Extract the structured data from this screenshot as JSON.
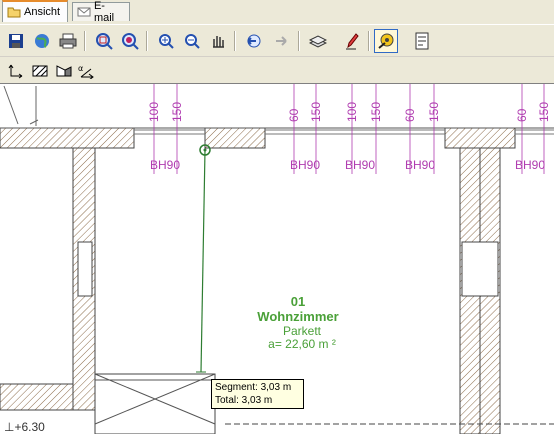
{
  "tabs": [
    {
      "label": "Ansicht",
      "icon": "folder-icon",
      "active": true
    },
    {
      "label": "E-mail",
      "icon": "envelope-icon",
      "active": false
    }
  ],
  "toolbar": {
    "row1": [
      "save-icon",
      "globe-icon",
      "printer-icon",
      "zoom-window-icon",
      "zoom-extents-icon",
      "zoom-in-icon",
      "zoom-out-icon",
      "pan-hand-icon",
      "undo-view-icon",
      "redo-view-icon",
      "layers-icon",
      "pencil-icon",
      "measure-tape-icon",
      "properties-icon"
    ],
    "row2": [
      "dimension-point-icon",
      "hatch-icon",
      "hatch-area-icon",
      "angle-icon"
    ],
    "active_tool": "measure-tape-icon"
  },
  "drawing": {
    "window_dims": [
      "100",
      "150",
      "60",
      "150",
      "100",
      "150",
      "60",
      "150",
      "60",
      "150"
    ],
    "window_labels": [
      "BH90",
      "BH90",
      "BH90",
      "BH90",
      "BH90"
    ],
    "room": {
      "number": "01",
      "name": "Wohnzimmer",
      "floor": "Parkett",
      "area": "a= 22,60 m ²"
    },
    "elevation": "+6.30",
    "colors": {
      "dimension": "#b03cb0",
      "room_text": "#4aa038",
      "measure_line": "#2e7d32",
      "hatch": "#8b6b4a"
    }
  },
  "tooltip": {
    "segment": "Segment: 3,03 m",
    "total": "Total: 3,03 m"
  }
}
